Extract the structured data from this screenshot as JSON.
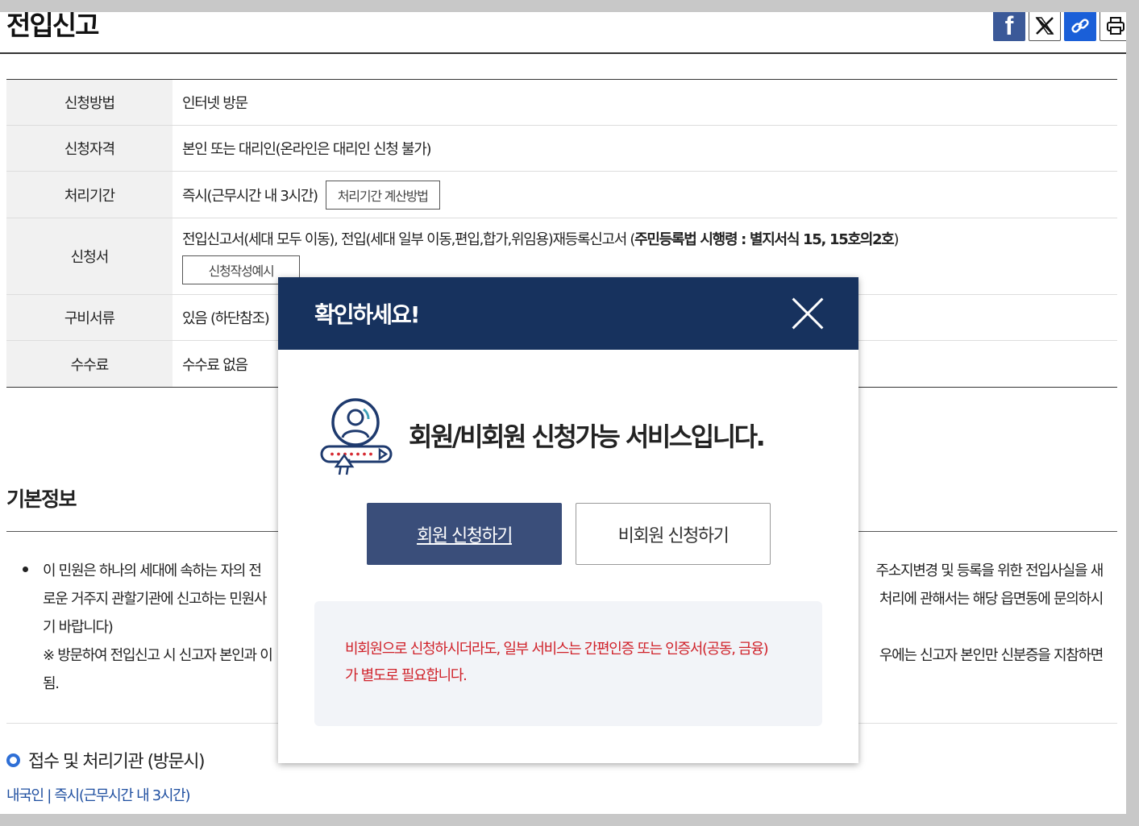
{
  "page": {
    "title": "전입신고"
  },
  "share": {
    "icons": [
      "facebook-icon",
      "x-twitter-icon",
      "link-icon",
      "print-icon"
    ]
  },
  "info_table": {
    "rows": [
      {
        "label": "신청방법",
        "value": "인터넷 방문"
      },
      {
        "label": "신청자격",
        "value": "본인 또는 대리인(온라인은 대리인 신청 불가)"
      },
      {
        "label": "처리기간",
        "value": "즉시(근무시간 내 3시간)",
        "button": "처리기간 계산방법"
      },
      {
        "label": "신청서",
        "value_prefix": "전입신고서(세대 모두 이동), 전입(세대 일부 이동,편입,합가,위임용)재등록신고서 (",
        "value_bold": "주민등록법 시행령 : 별지서식 15, 15호의2호",
        "value_suffix": ")",
        "button": "신청작성예시"
      },
      {
        "label": "구비서류",
        "value": "있음 (하단참조)"
      },
      {
        "label": "수수료",
        "value": "수수료 없음"
      }
    ]
  },
  "basic_info": {
    "title": "기본정보",
    "line1_left": "이 민원은 하나의 세대에 속하는 자의 전",
    "line1_right": "주소지변경 및 등록을 위한 전입사실을 새",
    "line2_left": "로운 거주지 관할기관에 신고하는 민원사",
    "line2_right": "처리에 관해서는 해당 읍면동에 문의하시",
    "line3": "기 바랍니다)",
    "line4_left": "※ 방문하여 전입신고 시 신고자 본인과 이",
    "line4_right": "우에는 신고자 본인만 신분증을 지참하면",
    "line5": "됨."
  },
  "processing": {
    "title": "접수 및 처리기관 (방문시)",
    "link": "내국인 | 즉시(근무시간 내 3시간)"
  },
  "modal": {
    "title": "확인하세요!",
    "message": "회원/비회원 신청가능 서비스입니다.",
    "member_button": "회원 신청하기",
    "nonmember_button": "비회원 신청하기",
    "notice_line1": "비회원으로 신청하시더라도, 일부 서비스는 간편인증 또는 인증서(공동, 금융)",
    "notice_line2": "가 별도로 필요합니다.",
    "colors": {
      "header": "#17325e",
      "primary_button": "#3a4e7a",
      "notice_text": "#d0222a"
    }
  }
}
